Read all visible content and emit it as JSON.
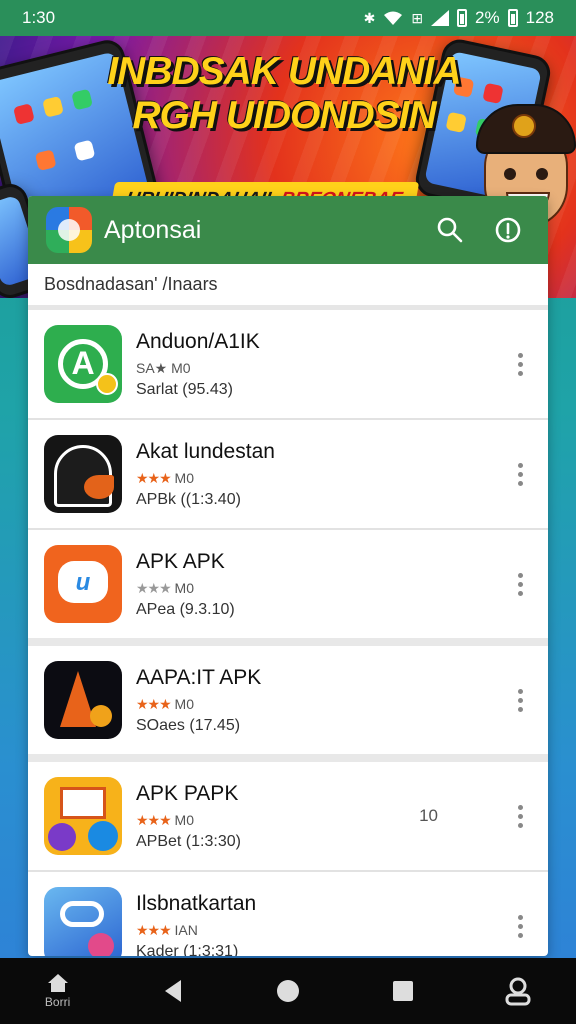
{
  "status_bar": {
    "time": "1:30",
    "battery_text": "2%",
    "extra_number": "128",
    "icons": [
      "bluetooth-icon",
      "wifi-icon",
      "data-icon",
      "signal-icon",
      "battery-icon"
    ]
  },
  "banner": {
    "headline_line1": "INBDSAK UNDANIA",
    "headline_line2": "RGH UIDONDSIN",
    "tagline_left": "URUIDINDAUAII",
    "tagline_right": "BREONEBAE"
  },
  "appbar": {
    "title": "Aptonsai",
    "actions": [
      "search-icon",
      "info-icon"
    ],
    "color": "#3a8a4a"
  },
  "breadcrumb": "Bosdnadasan' /Inaars",
  "apps": [
    {
      "title": "Anduon/A1IK",
      "rating_label": "SA★ M0",
      "sub": "Sarlat (95.43)",
      "icon": "green-gear-app-icon"
    },
    {
      "title": "Akat lundestan",
      "rating_label": "M0",
      "sub": "APBk ((1:3.40)",
      "icon": "dark-helmet-app-icon"
    },
    {
      "title": "APK APK",
      "rating_label": "M0",
      "sub": "APea (9.3.10)",
      "icon": "orange-chat-app-icon"
    },
    {
      "title": "AAPA:IT APK",
      "rating_label": "M0",
      "sub": "SOaes (17.45)",
      "icon": "black-cone-app-icon"
    },
    {
      "title": "APK PAPK",
      "rating_label": "M0",
      "sub": "APBet (1:3:30)",
      "count": "10",
      "icon": "yellow-mail-app-icon"
    },
    {
      "title": "Ilsbnatkartan",
      "rating_label": "IAN",
      "sub": "Kader (1:3:31)",
      "icon": "blue-loop-app-icon"
    }
  ],
  "navbar": {
    "home_label": "Borri"
  }
}
